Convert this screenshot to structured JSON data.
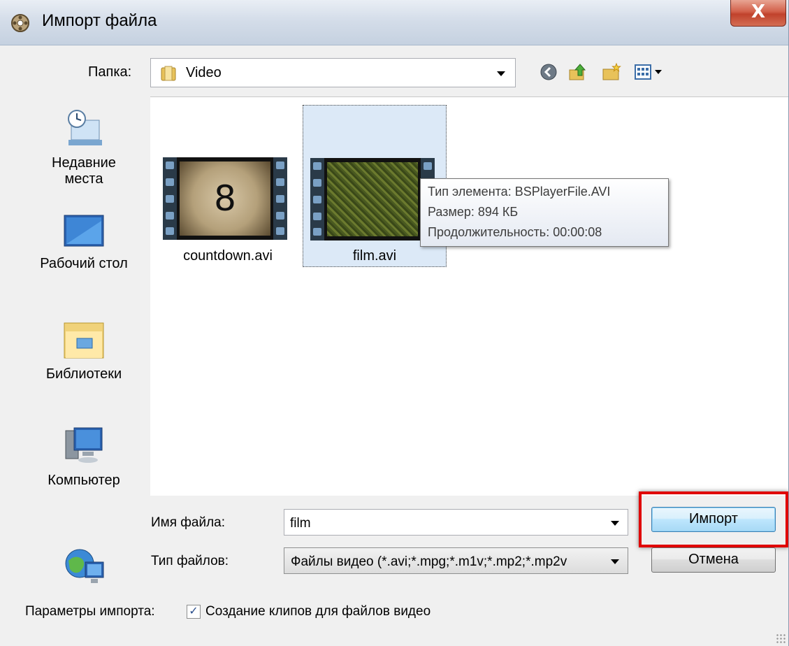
{
  "window": {
    "title": "Импорт файла",
    "close_label": "X"
  },
  "folder": {
    "label": "Папка:",
    "value": "Video"
  },
  "toolbar": {
    "icons": [
      "back-icon",
      "up-folder-icon",
      "new-folder-icon",
      "view-menu-icon"
    ]
  },
  "places": [
    {
      "label_line1": "Недавние",
      "label_line2": "места",
      "icon": "recent-places-icon"
    },
    {
      "label_line1": "Рабочий стол",
      "label_line2": "",
      "icon": "desktop-icon"
    },
    {
      "label_line1": "Библиотеки",
      "label_line2": "",
      "icon": "libraries-icon"
    },
    {
      "label_line1": "Компьютер",
      "label_line2": "",
      "icon": "computer-icon"
    },
    {
      "label_line1": "",
      "label_line2": "",
      "icon": "network-icon"
    }
  ],
  "files": [
    {
      "name": "countdown.avi",
      "thumb_text": "8",
      "selected": false
    },
    {
      "name": "film.avi",
      "thumb_text": "",
      "selected": true
    }
  ],
  "tooltip": {
    "type": "Тип элемента: BSPlayerFile.AVI",
    "size": "Размер: 894 КБ",
    "duration": "Продолжительность: 00:00:08"
  },
  "filename": {
    "label": "Имя файла:",
    "value": "film"
  },
  "filetype": {
    "label": "Тип файлов:",
    "value": "Файлы видео (*.avi;*.mpg;*.m1v;*.mp2;*.mp2v"
  },
  "buttons": {
    "import": "Импорт",
    "cancel": "Отмена"
  },
  "options": {
    "label": "Параметры импорта:",
    "checkbox_label": "Создание клипов для файлов видео",
    "checked": true,
    "check_glyph": "✓"
  }
}
